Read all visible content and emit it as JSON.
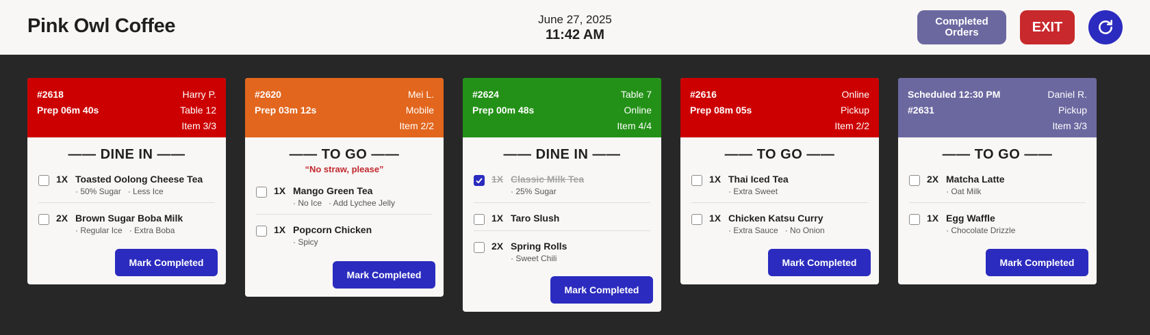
{
  "header": {
    "brand": "Pink Owl Coffee",
    "date": "June 27, 2025",
    "time": "11:42 AM",
    "completed_line1": "Completed",
    "completed_line2": "Orders",
    "exit_label": "EXIT",
    "refresh_icon": "refresh-icon"
  },
  "colors": {
    "urgent": "#cc0000",
    "warning": "#e2661d",
    "fresh": "#239117",
    "scheduled": "#6b68a0",
    "primary": "#2b2bbf",
    "exit": "#c8292c"
  },
  "orders": [
    {
      "left1": "#2618",
      "left2": "Prep 06m 40s",
      "right1": "Harry P.",
      "right2": "Table 12",
      "right3": "Item 3/3",
      "section": "—— DINE IN ——",
      "note": "",
      "items": [
        {
          "qty": "1X",
          "name": "Toasted Oolong Cheese Tea",
          "mod1": "· 50% Sugar",
          "mod2": "· Less Ice",
          "checked": false
        },
        {
          "qty": "2X",
          "name": "Brown Sugar Boba Milk",
          "mod1": "· Regular Ice",
          "mod2": "· Extra Boba",
          "checked": false
        }
      ],
      "button": "Mark Completed"
    },
    {
      "left1": "#2620",
      "left2": "Prep 03m 12s",
      "right1": "Mei L.",
      "right2": "Mobile",
      "right3": "Item 2/2",
      "section": "—— TO GO ——",
      "note": "“No straw, please”",
      "items": [
        {
          "qty": "1X",
          "name": "Mango Green Tea",
          "mod1": "· No Ice",
          "mod2": "· Add Lychee Jelly",
          "checked": false
        },
        {
          "qty": "1X",
          "name": "Popcorn Chicken",
          "mod1": "· Spicy",
          "mod2": "",
          "checked": false
        }
      ],
      "button": "Mark Completed"
    },
    {
      "left1": "#2624",
      "left2": "Prep 00m 48s",
      "right1": "Table 7",
      "right2": "Online",
      "right3": "Item 4/4",
      "section": "—— DINE IN ——",
      "note": "",
      "items": [
        {
          "qty": "1X",
          "name": "Classic Milk Tea",
          "mod1": "· 25% Sugar",
          "mod2": "",
          "checked": true
        },
        {
          "qty": "1X",
          "name": "Taro Slush",
          "mod1": "",
          "mod2": "",
          "checked": false
        },
        {
          "qty": "2X",
          "name": "Spring Rolls",
          "mod1": "· Sweet Chili",
          "mod2": "",
          "checked": false
        }
      ],
      "button": "Mark Completed"
    },
    {
      "left1": "#2616",
      "left2": "Prep 08m 05s",
      "right1": "Online",
      "right2": "Pickup",
      "right3": "Item 2/2",
      "section": "—— TO GO ——",
      "note": "",
      "items": [
        {
          "qty": "1X",
          "name": "Thai Iced Tea",
          "mod1": "· Extra Sweet",
          "mod2": "",
          "checked": false
        },
        {
          "qty": "1X",
          "name": "Chicken Katsu Curry",
          "mod1": "· Extra Sauce",
          "mod2": "· No Onion",
          "checked": false
        }
      ],
      "button": "Mark Completed"
    },
    {
      "left1": "Scheduled 12:30 PM",
      "left2": "#2631",
      "right1": "Daniel R.",
      "right2": "Pickup",
      "right3": "Item 3/3",
      "section": "—— TO GO ——",
      "note": "",
      "items": [
        {
          "qty": "2X",
          "name": "Matcha Latte",
          "mod1": "· Oat Milk",
          "mod2": "",
          "checked": false
        },
        {
          "qty": "1X",
          "name": "Egg Waffle",
          "mod1": "· Chocolate Drizzle",
          "mod2": "",
          "checked": false
        }
      ],
      "button": "Mark Completed"
    }
  ]
}
